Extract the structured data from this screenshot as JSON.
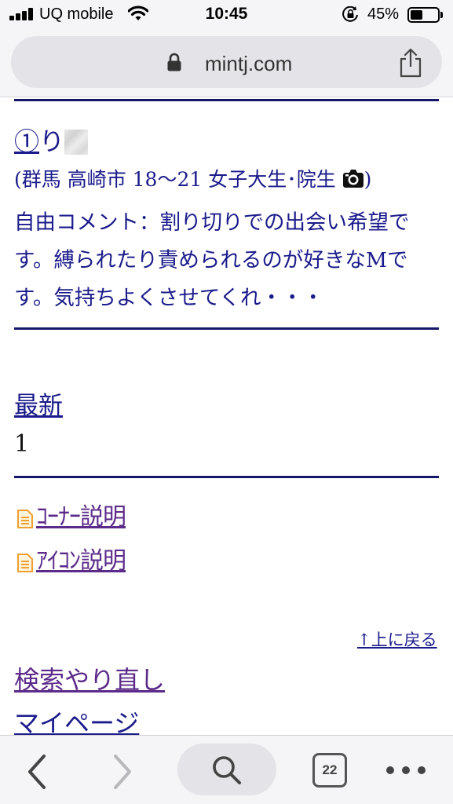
{
  "status_bar": {
    "carrier": "UQ mobile",
    "time": "10:45",
    "battery_percent": "45%",
    "battery_level": 0.45
  },
  "browser": {
    "url": "mintj.com",
    "tab_count": "22"
  },
  "entry": {
    "number": "①",
    "name_visible": "り",
    "meta_before_icon": "(群馬 高崎市 18〜21 女子大生･院生",
    "meta_after_icon": ")",
    "comment": "自由コメント：割り切りでの出会い希望です。縛られたり責められるのが好きなMです。気持ちよくさせてくれ・・・"
  },
  "pagination": {
    "latest_label": "最新",
    "page_number": "1"
  },
  "links": {
    "corner_help": "ｺｰﾅｰ説明",
    "icon_help": "ｱｲｺﾝ説明",
    "back_to_top": "↑上に戻る",
    "search_again": "検索やり直し",
    "mypage": "マイページ"
  },
  "colors": {
    "link": "#1b1b8c",
    "visited_link": "#5c2b8a",
    "rule": "#16166b",
    "doc_icon": "#f0a030"
  },
  "icons": {
    "camera": "camera-icon",
    "doc": "document-icon",
    "share": "share-icon",
    "lock": "lock-icon"
  }
}
